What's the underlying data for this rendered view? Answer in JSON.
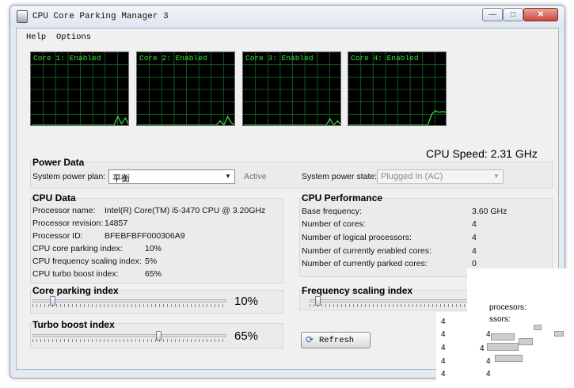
{
  "window": {
    "title": "CPU Core Parking Manager 3"
  },
  "menu": {
    "items": [
      "Help",
      "Options"
    ]
  },
  "monitors": [
    {
      "label": "Core 1: Enabled",
      "load": [
        0,
        0,
        0,
        0,
        0,
        0,
        0,
        0,
        0,
        0,
        0,
        0,
        0,
        0,
        0,
        0,
        0,
        0,
        0,
        0,
        0,
        0,
        0,
        0.12,
        0.02,
        0.1,
        0
      ]
    },
    {
      "label": "Core 2: Enabled",
      "load": [
        0,
        0,
        0,
        0,
        0,
        0,
        0,
        0,
        0,
        0,
        0,
        0,
        0,
        0,
        0,
        0,
        0,
        0,
        0,
        0,
        0,
        0,
        0.06,
        0,
        0.12,
        0.03,
        0
      ]
    },
    {
      "label": "Core 3: Enabled",
      "load": [
        0,
        0,
        0,
        0,
        0,
        0,
        0,
        0,
        0,
        0,
        0,
        0,
        0,
        0,
        0,
        0,
        0,
        0,
        0,
        0,
        0,
        0,
        0,
        0.09,
        0,
        0.06,
        0
      ]
    },
    {
      "label": "Core 4: Enabled",
      "load": [
        0,
        0,
        0,
        0,
        0,
        0,
        0,
        0,
        0,
        0,
        0,
        0,
        0,
        0,
        0,
        0,
        0,
        0,
        0,
        0,
        0,
        0,
        0.15,
        0.2,
        0.18,
        0.19,
        0.18
      ]
    }
  ],
  "cpu_speed": "CPU Speed: 2.31 GHz",
  "power_data": {
    "header": "Power Data",
    "plan_label": "System power plan:",
    "plan_value": "平衡",
    "active_label": "Active",
    "state_label": "System power state:",
    "state_value": "Plugged In (AC)"
  },
  "cpu_data": {
    "header": "CPU Data",
    "rows": [
      {
        "label": "Processor name:",
        "value": "Intel(R) Core(TM) i5-3470 CPU @ 3.20GHz"
      },
      {
        "label": "Processor revision:",
        "value": "14857"
      },
      {
        "label": "Processor ID:",
        "value": "BFEBFBFF000306A9"
      },
      {
        "label": "CPU core parking index:",
        "value": "10%"
      },
      {
        "label": "CPU frequency scaling index:",
        "value": "5%"
      },
      {
        "label": "CPU turbo boost index:",
        "value": "65%"
      }
    ]
  },
  "cpu_performance": {
    "header": "CPU Performance",
    "rows": [
      {
        "label": "Base frequency:",
        "value": "3.60 GHz"
      },
      {
        "label": "Number of cores:",
        "value": "4"
      },
      {
        "label": "Number of logical processors:",
        "value": "4"
      },
      {
        "label": "Number of currently enabled cores:",
        "value": "4"
      },
      {
        "label": "Number of currently parked cores:",
        "value": "0"
      }
    ]
  },
  "core_parking": {
    "header": "Core parking index",
    "value_text": "10%",
    "value": 0.1
  },
  "turbo_boost": {
    "header": "Turbo boost index",
    "value_text": "65%",
    "value": 0.65
  },
  "frequency_scaling": {
    "header": "Frequency scaling index",
    "value": 0.05
  },
  "refresh_label": "Refresh",
  "ghost": {
    "line1": "procesors:",
    "line2": "ssors:",
    "values": [
      "4",
      "4",
      "4",
      "4",
      "4",
      "4",
      "4",
      "4",
      "4"
    ]
  }
}
